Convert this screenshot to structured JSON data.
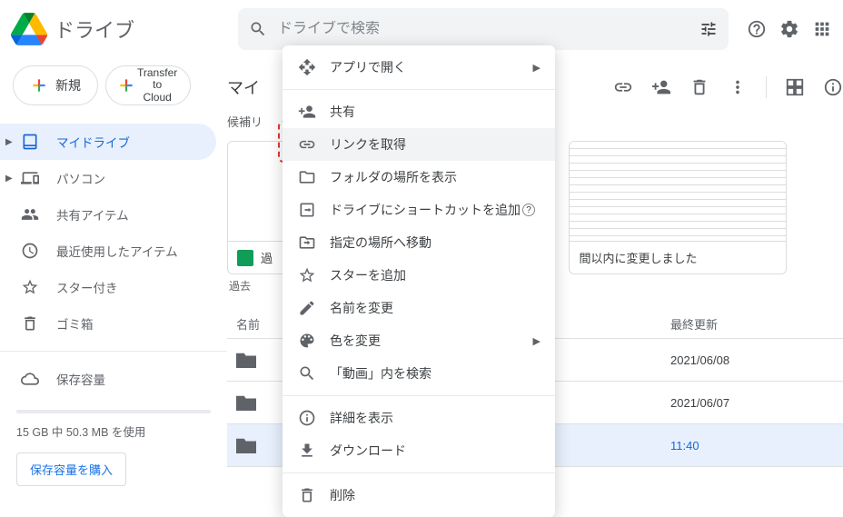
{
  "header": {
    "app_name": "ドライブ",
    "search_placeholder": "ドライブで検索"
  },
  "sidebar": {
    "buttons": {
      "new": "新規",
      "transfer1": "Transfer",
      "transfer2": "to",
      "transfer3": "Cloud"
    },
    "items": [
      {
        "label": "マイドライブ"
      },
      {
        "label": "パソコン"
      },
      {
        "label": "共有アイテム"
      },
      {
        "label": "最近使用したアイテム"
      },
      {
        "label": "スター付き"
      },
      {
        "label": "ゴミ箱"
      }
    ],
    "storage_label": "保存容量",
    "storage_usage": "15 GB 中 50.3 MB を使用",
    "storage_buy": "保存容量を購入"
  },
  "content": {
    "crumb": "マイ",
    "suggest": "候補リ",
    "card_title": "過",
    "card_subtext": "過去",
    "card2_subtext": "間以内に変更しました",
    "list_head_name": "名前",
    "list_head_date": "最終更新",
    "rows": [
      {
        "name": "",
        "date": "2021/06/08"
      },
      {
        "name": "",
        "date": "2021/06/07"
      },
      {
        "name": "",
        "date": "11:40"
      }
    ]
  },
  "menu": {
    "items": [
      {
        "label": "アプリで開く",
        "icon": "open-with",
        "sub": true
      },
      {
        "sep": true
      },
      {
        "label": "共有",
        "icon": "person-add"
      },
      {
        "label": "リンクを取得",
        "icon": "link",
        "hover": true,
        "highlight": true
      },
      {
        "label": "フォルダの場所を表示",
        "icon": "folder"
      },
      {
        "label": "ドライブにショートカットを追加",
        "icon": "shortcut",
        "help": true
      },
      {
        "label": "指定の場所へ移動",
        "icon": "move"
      },
      {
        "label": "スターを追加",
        "icon": "star"
      },
      {
        "label": "名前を変更",
        "icon": "rename"
      },
      {
        "label": "色を変更",
        "icon": "palette",
        "sub": true
      },
      {
        "label": "「動画」内を検索",
        "icon": "search"
      },
      {
        "sep": true
      },
      {
        "label": "詳細を表示",
        "icon": "info"
      },
      {
        "label": "ダウンロード",
        "icon": "download"
      },
      {
        "sep": true
      },
      {
        "label": "削除",
        "icon": "trash"
      }
    ]
  }
}
